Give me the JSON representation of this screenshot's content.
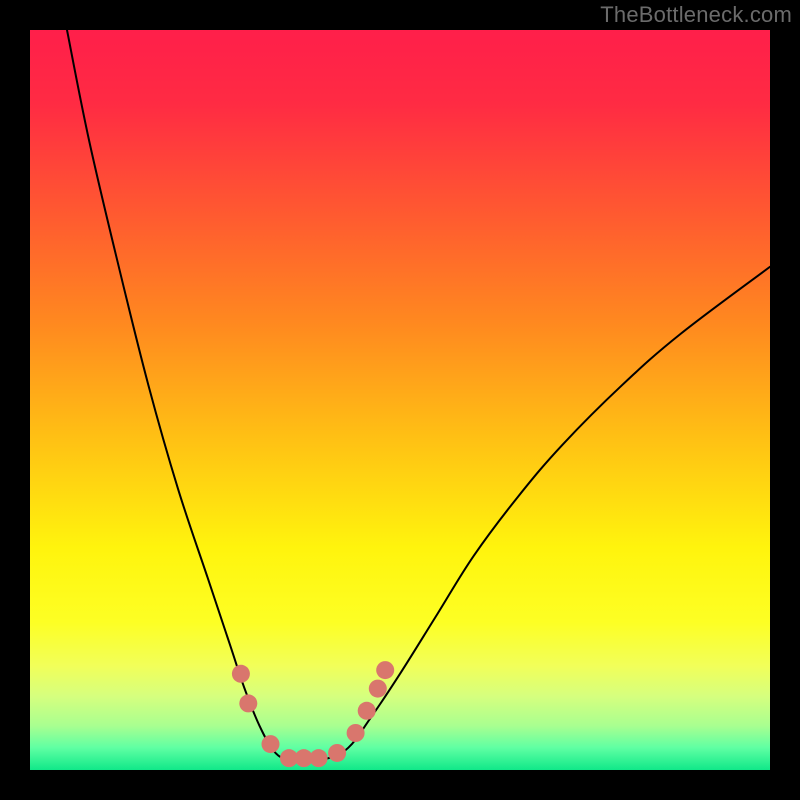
{
  "watermark": "TheBottleneck.com",
  "chart_data": {
    "type": "line",
    "title": "",
    "xlabel": "",
    "ylabel": "",
    "xlim": [
      0,
      100
    ],
    "ylim": [
      0,
      100
    ],
    "background_gradient": {
      "stops": [
        {
          "offset": 0.0,
          "color": "#ff1f4a"
        },
        {
          "offset": 0.1,
          "color": "#ff2b43"
        },
        {
          "offset": 0.25,
          "color": "#ff5a30"
        },
        {
          "offset": 0.4,
          "color": "#ff8a1f"
        },
        {
          "offset": 0.55,
          "color": "#ffc014"
        },
        {
          "offset": 0.7,
          "color": "#fff40d"
        },
        {
          "offset": 0.8,
          "color": "#fdff24"
        },
        {
          "offset": 0.86,
          "color": "#f1ff5a"
        },
        {
          "offset": 0.9,
          "color": "#d6ff7e"
        },
        {
          "offset": 0.94,
          "color": "#a9ff90"
        },
        {
          "offset": 0.97,
          "color": "#5fffa3"
        },
        {
          "offset": 1.0,
          "color": "#10e889"
        }
      ]
    },
    "series": [
      {
        "name": "bottleneck-curve",
        "color": "#000000",
        "width": 2,
        "x": [
          5,
          8,
          12,
          16,
          20,
          24,
          27,
          29,
          31,
          33,
          35,
          37,
          40,
          43,
          46,
          50,
          55,
          60,
          66,
          72,
          80,
          88,
          100
        ],
        "y": [
          100,
          85,
          68,
          52,
          38,
          26,
          17,
          11,
          6,
          2.5,
          1.3,
          1.3,
          1.5,
          3,
          7,
          13,
          21,
          29,
          37,
          44,
          52,
          59,
          68
        ]
      }
    ],
    "markers": {
      "name": "highlight-dots",
      "color": "#d9766d",
      "radius": 9,
      "points": [
        {
          "x": 28.5,
          "y": 13
        },
        {
          "x": 29.5,
          "y": 9
        },
        {
          "x": 32.5,
          "y": 3.5
        },
        {
          "x": 35.0,
          "y": 1.6
        },
        {
          "x": 37.0,
          "y": 1.6
        },
        {
          "x": 39.0,
          "y": 1.6
        },
        {
          "x": 41.5,
          "y": 2.3
        },
        {
          "x": 44.0,
          "y": 5
        },
        {
          "x": 45.5,
          "y": 8
        },
        {
          "x": 47.0,
          "y": 11
        },
        {
          "x": 48.0,
          "y": 13.5
        }
      ]
    }
  }
}
